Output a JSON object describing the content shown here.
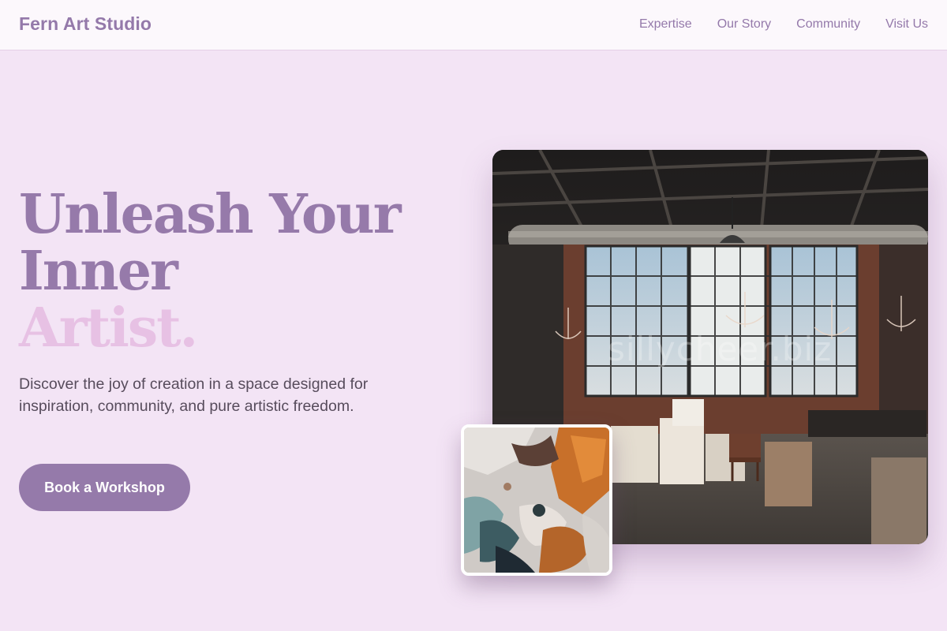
{
  "brand": {
    "name": "Fern Art Studio"
  },
  "nav": {
    "items": [
      {
        "label": "Expertise"
      },
      {
        "label": "Our Story"
      },
      {
        "label": "Community"
      },
      {
        "label": "Visit Us"
      }
    ]
  },
  "hero": {
    "title_line1": "Unleash Your",
    "title_line2": "Inner",
    "title_line3": "Artist.",
    "description": "Discover the joy of creation in a space designed for inspiration, community, and pure artistic freedom.",
    "cta_label": "Book a Workshop"
  },
  "images": {
    "main_alt": "Industrial art studio with large windows and chandeliers",
    "inset_alt": "Close-up of textured paint palette"
  },
  "watermark": "sillycheer.biz",
  "colors": {
    "brand_purple": "#957aaa",
    "accent_pink": "#e7c1e4",
    "page_background": "#f3e4f5",
    "header_background": "#fcf8fc"
  }
}
